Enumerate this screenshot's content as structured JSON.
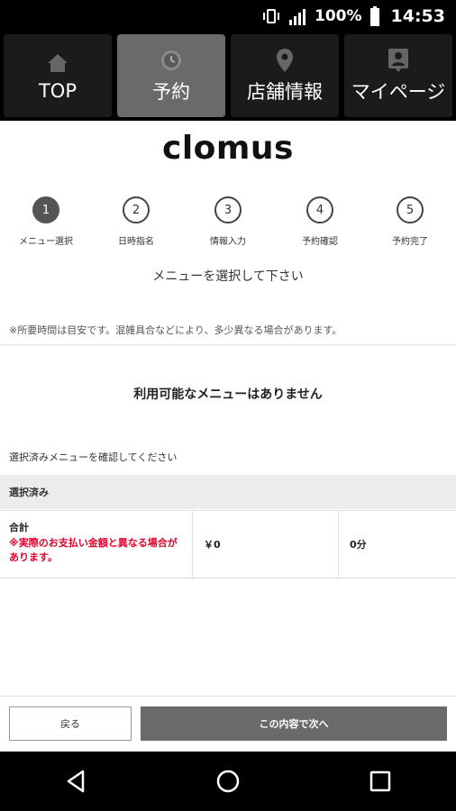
{
  "status_bar": {
    "battery_percent": "100%",
    "time": "14:53",
    "icons": [
      "vibrate-icon",
      "signal-icon",
      "battery-icon"
    ]
  },
  "nav_tabs": [
    {
      "label": "TOP",
      "icon": "home-icon",
      "active": false
    },
    {
      "label": "予約",
      "icon": "clock-icon",
      "active": true
    },
    {
      "label": "店舗情報",
      "icon": "map-pin-icon",
      "active": false
    },
    {
      "label": "マイページ",
      "icon": "user-card-icon",
      "active": false
    }
  ],
  "brand": "clomus",
  "steps": [
    {
      "number": "1",
      "label": "メニュー選択",
      "current": true
    },
    {
      "number": "2",
      "label": "日時指名",
      "current": false
    },
    {
      "number": "3",
      "label": "情報入力",
      "current": false
    },
    {
      "number": "4",
      "label": "予約確認",
      "current": false
    },
    {
      "number": "5",
      "label": "予約完了",
      "current": false
    }
  ],
  "subhead": "メニューを選択して下さい",
  "note": "※所要時間は目安です。混雑具合などにより、多少異なる場合があります。",
  "empty_message": "利用可能なメニューはありません",
  "confirm_note": "選択済みメニューを確認してください",
  "selected_header": "選択済み",
  "total": {
    "label": "合計",
    "warning": "※実際のお支払い金額と異なる場合があります。",
    "price": "￥0",
    "duration": "0分"
  },
  "buttons": {
    "back": "戻る",
    "next": "この内容で次へ"
  },
  "colors": {
    "accent_gray": "#6a6a6a",
    "warning_red": "#e4002b",
    "bar_black": "#000000"
  }
}
